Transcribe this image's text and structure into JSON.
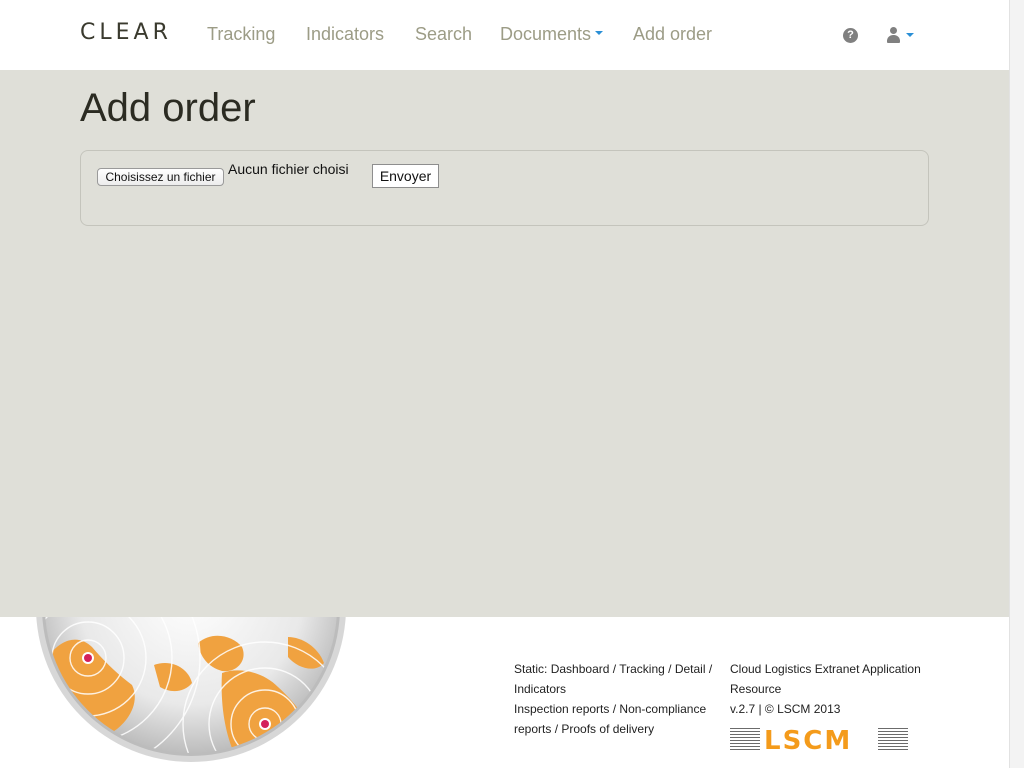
{
  "header": {
    "brand": "CLEAR",
    "nav": {
      "tracking": "Tracking",
      "indicators": "Indicators",
      "search": "Search",
      "documents": "Documents",
      "add_order": "Add order"
    },
    "help_icon": "question-circle-icon",
    "user_icon": "user-icon",
    "accent_color": "#2a8fd6"
  },
  "main": {
    "title": "Add order",
    "upload": {
      "file_button": "Choisissez un fichier",
      "file_status": "Aucun fichier choisi",
      "submit_button": "Envoyer"
    }
  },
  "footer": {
    "links_prefix": "Static:",
    "links": {
      "dashboard": "Dashboard",
      "tracking": "Tracking",
      "detail": "Detail",
      "indicators": "Indicators",
      "inspection": "Inspection reports",
      "noncompliance": "Non-compliance reports",
      "proofs": "Proofs of delivery"
    },
    "app_name": "Cloud Logistics Extranet Application Resource",
    "version": "v.2.7 | © LSCM 2013",
    "logo_text": "LSCM",
    "logo_color": "#f49b1b"
  }
}
